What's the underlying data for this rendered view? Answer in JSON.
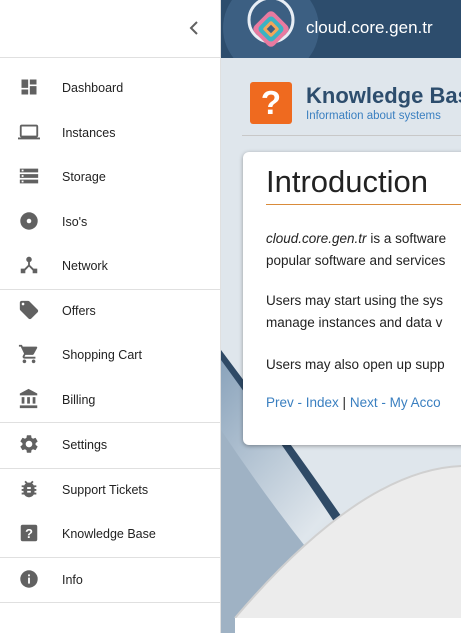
{
  "sidebar": {
    "items": [
      {
        "label": "Dashboard",
        "icon": "dashboard-icon"
      },
      {
        "label": "Instances",
        "icon": "laptop-icon"
      },
      {
        "label": "Storage",
        "icon": "storage-icon"
      },
      {
        "label": "Iso's",
        "icon": "disc-icon"
      },
      {
        "label": "Network",
        "icon": "network-icon"
      },
      {
        "label": "Offers",
        "icon": "tag-icon"
      },
      {
        "label": "Shopping Cart",
        "icon": "cart-icon"
      },
      {
        "label": "Billing",
        "icon": "bank-icon"
      },
      {
        "label": "Settings",
        "icon": "gear-icon"
      },
      {
        "label": "Support Tickets",
        "icon": "bug-icon"
      },
      {
        "label": "Knowledge Base",
        "icon": "help-icon"
      },
      {
        "label": "Info",
        "icon": "info-icon"
      }
    ]
  },
  "header": {
    "site_name": "cloud.core.gen.tr"
  },
  "kb": {
    "icon_glyph": "?",
    "title": "Knowledge Bas",
    "subtitle": "Information about systems"
  },
  "article": {
    "title": "Introduction",
    "p1": {
      "emph": "cloud.core.gen.tr",
      "line1": " is a software",
      "line2": "popular software and services"
    },
    "p2": {
      "line1": "Users may start using the sys",
      "line2": "manage instances and data v"
    },
    "p3": {
      "line1": "Users may also open up supp"
    },
    "links": {
      "prev": "Prev - Index",
      "separator": "|",
      "next": "Next - My Acco"
    }
  },
  "colors": {
    "header_bg": "#2d4d6d",
    "kb_icon_bg": "#ef6a1f",
    "link": "#3a7fc0",
    "title_rule": "#d98b3a",
    "icon": "#616161"
  }
}
